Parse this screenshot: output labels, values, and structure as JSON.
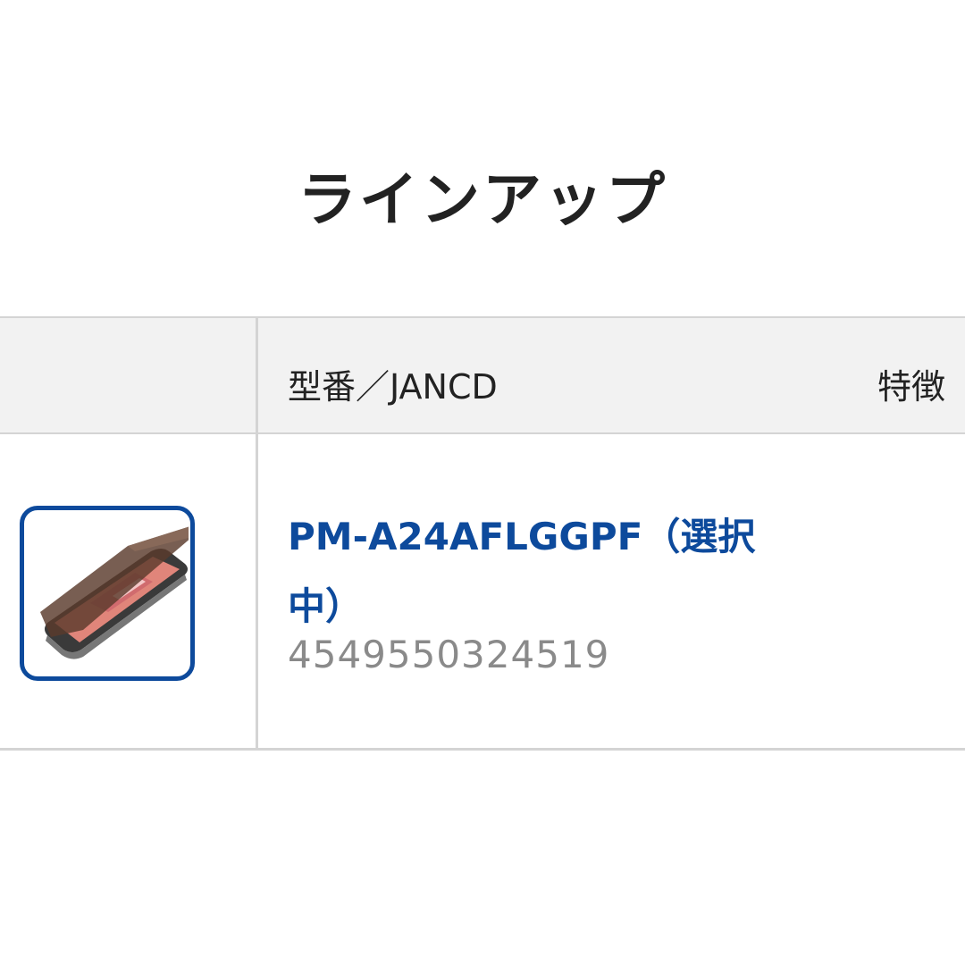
{
  "section": {
    "title": "ラインアップ"
  },
  "table": {
    "headers": {
      "model_jan": "型番／JANCD",
      "features": "特徴"
    },
    "rows": [
      {
        "image": "privacy-glass-screen-protector-product",
        "model_label": "PM-A24AFLGGPF（選択中）",
        "jan": "4549550324519",
        "selected": true
      }
    ]
  },
  "colors": {
    "accent": "#0d4a9c",
    "text": "#222222",
    "muted": "#8a8a8a",
    "header_bg": "#f2f2f2",
    "border": "#d4d4d4"
  }
}
